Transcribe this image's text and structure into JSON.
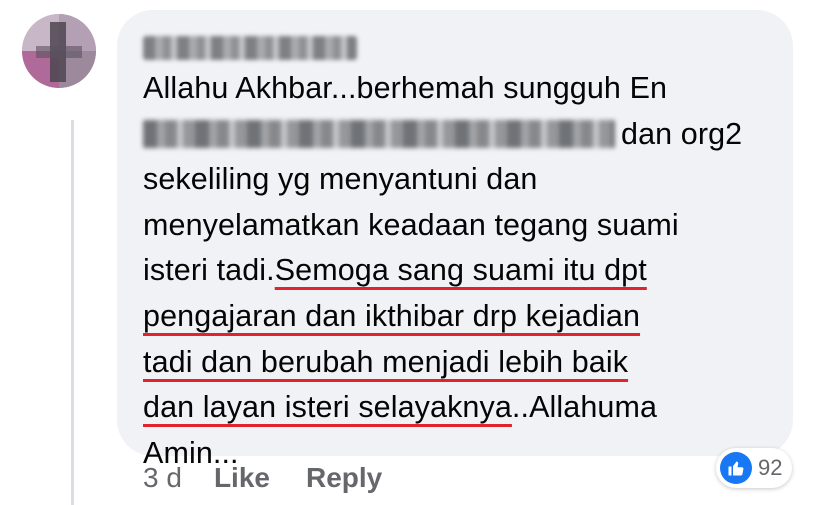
{
  "comment": {
    "lines": {
      "l1": "Allahu Akhbar...berhemah sungguh En",
      "l2_tail": "dan org2",
      "l3": "sekeliling yg menyantuni dan",
      "l4": "menyelamatkan keadaan tegang suami",
      "l5_start": "isteri tadi.",
      "l5_ul": "Semoga sang suami itu dpt",
      "l6_ul": "pengajaran dan ikthibar drp kejadian",
      "l7_ul": "tadi dan berubah menjadi lebih baik",
      "l8_ul": "dan layan isteri selayaknya",
      "l8_tail": "..Allahuma",
      "l9": "Amin..."
    },
    "underline_color": "#e0242b"
  },
  "actions": {
    "time": "3 d",
    "like_label": "Like",
    "reply_label": "Reply"
  },
  "reactions": {
    "icon": "thumbs-up-icon",
    "count": "92",
    "color": "#1877f2"
  }
}
